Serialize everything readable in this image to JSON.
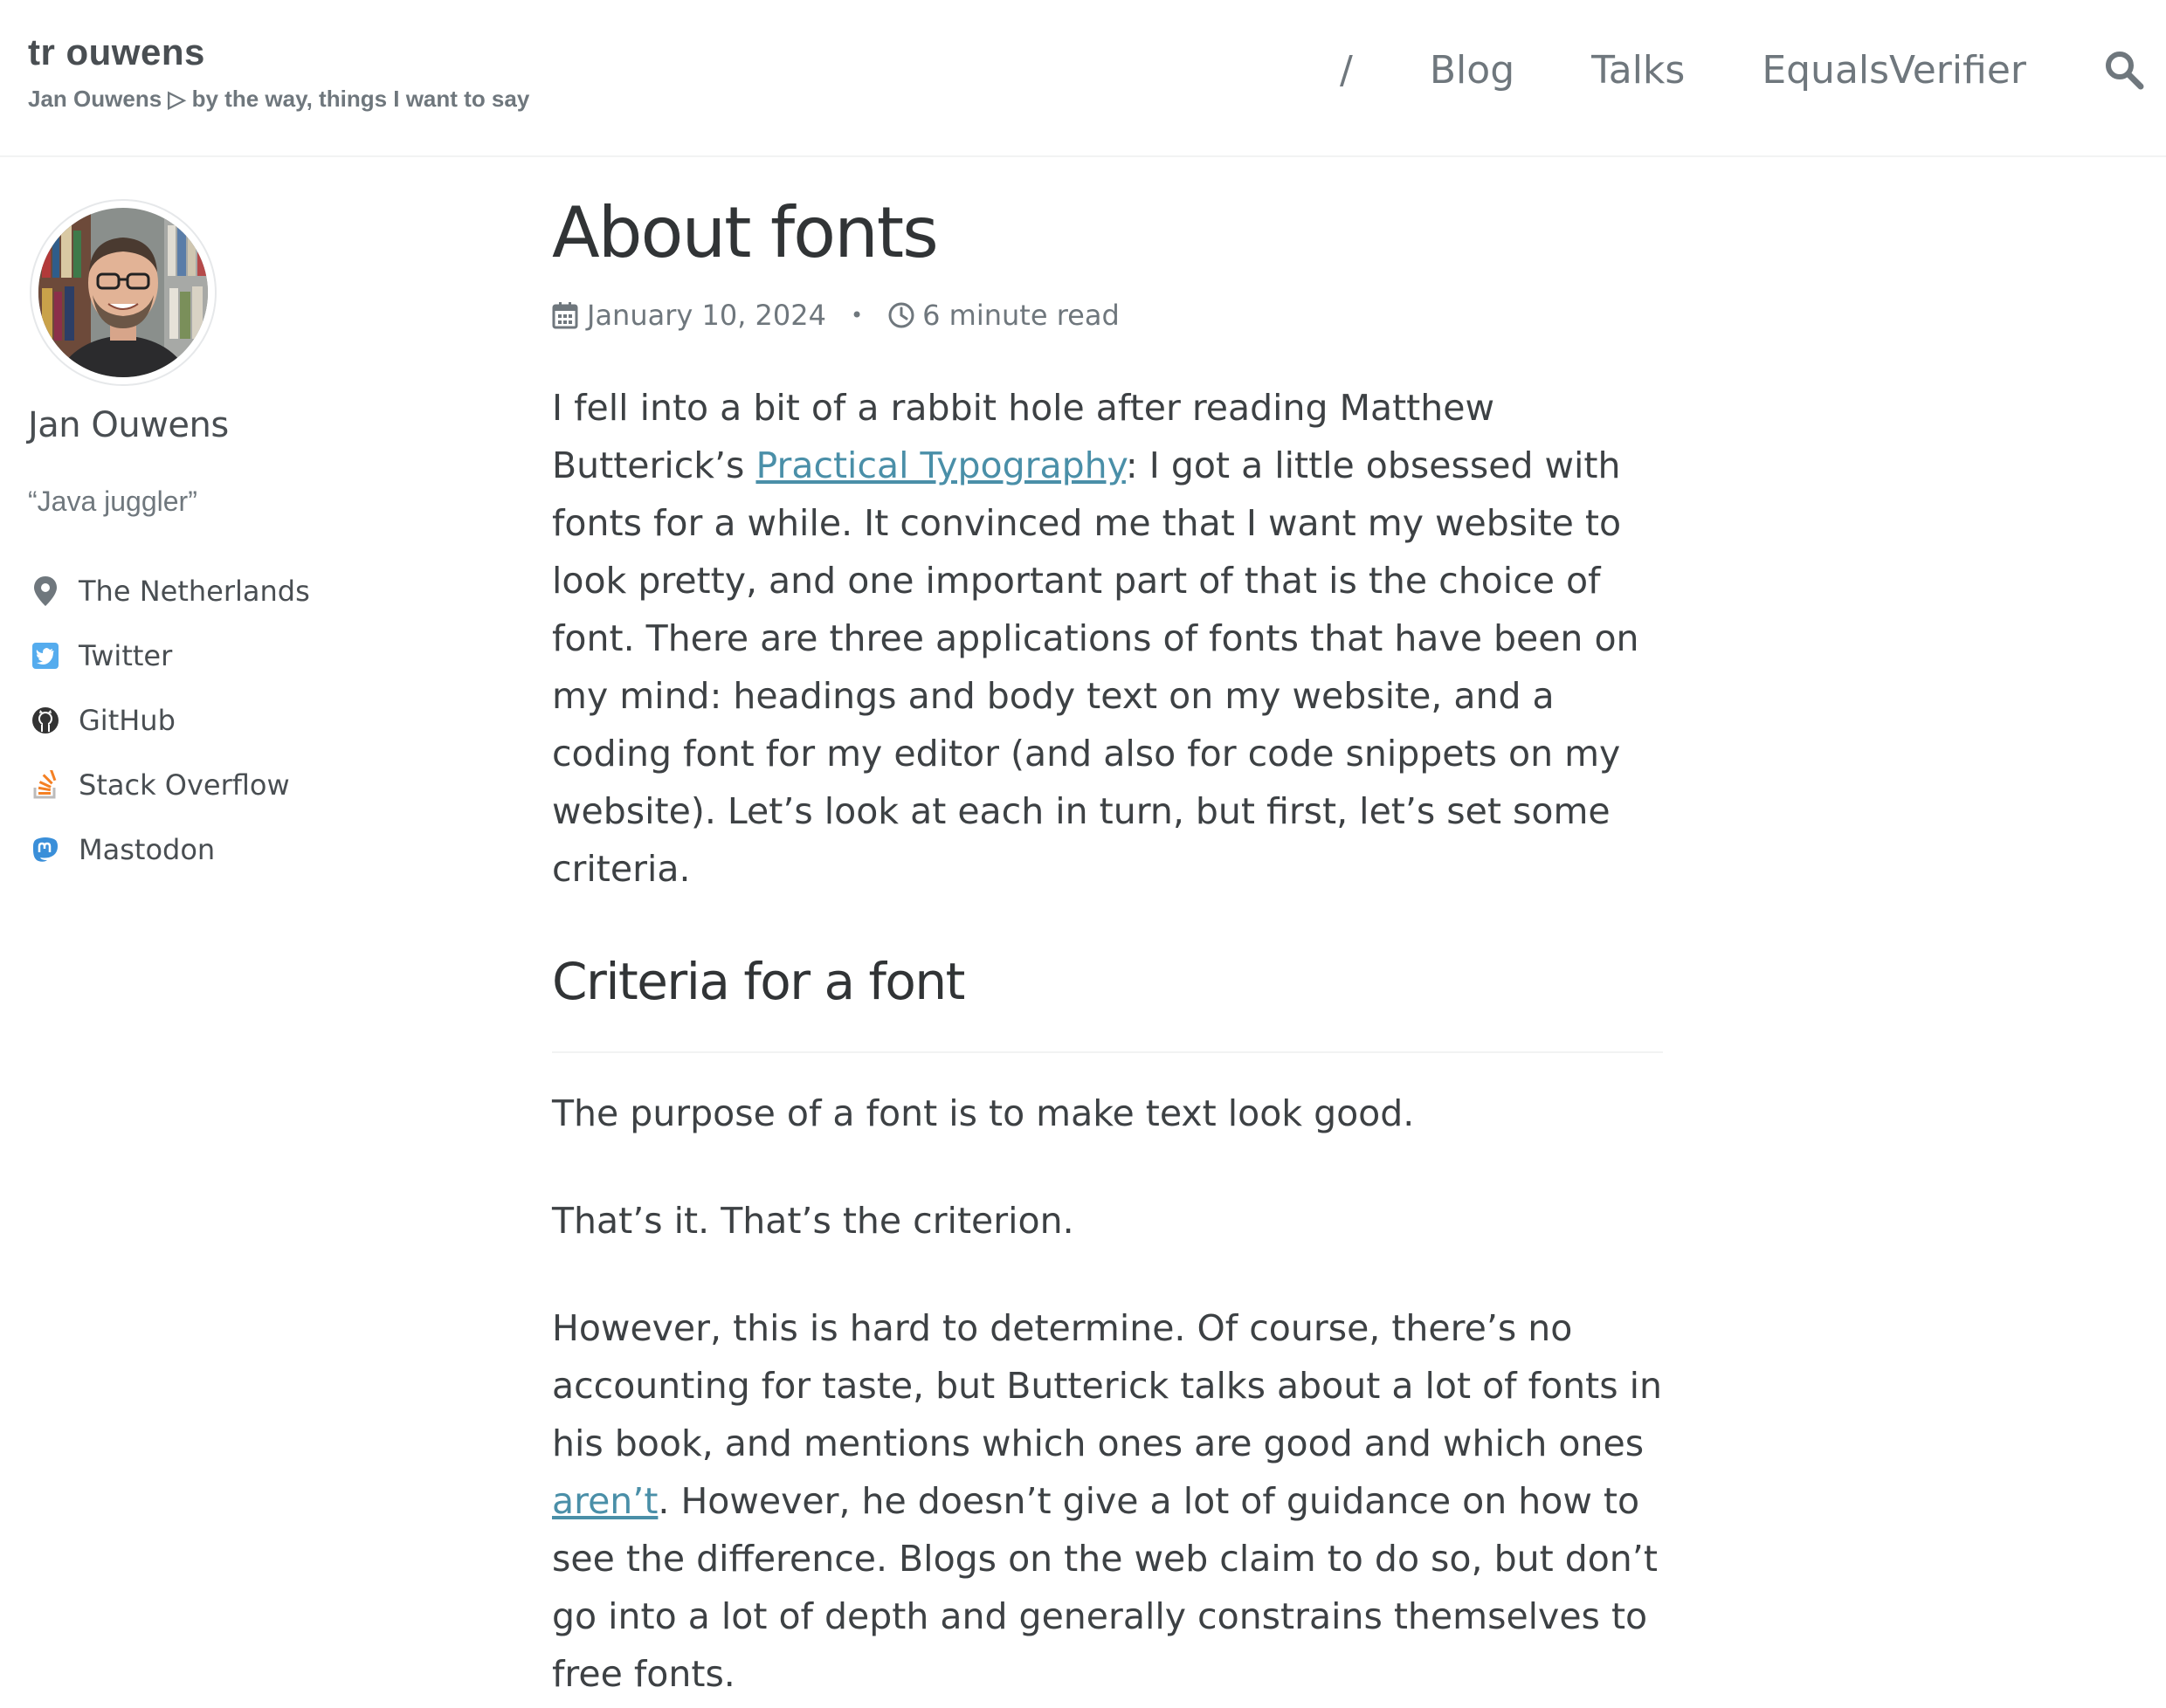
{
  "masthead": {
    "site_title": "tr ouwens",
    "site_subtitle": "Jan Ouwens ▷ by the way, things I want to say",
    "nav": [
      {
        "label": "/"
      },
      {
        "label": "Blog"
      },
      {
        "label": "Talks"
      },
      {
        "label": "EqualsVerifier"
      }
    ],
    "search_icon": "search-icon"
  },
  "sidebar": {
    "avatar": "author-photo",
    "name": "Jan Ouwens",
    "bio": "“Java juggler”",
    "links": [
      {
        "icon": "map-marker-icon",
        "label": "The Netherlands",
        "color": "#6f777d"
      },
      {
        "icon": "twitter-icon",
        "label": "Twitter",
        "color": "#55acee"
      },
      {
        "icon": "github-icon",
        "label": "GitHub",
        "color": "#333333"
      },
      {
        "icon": "stack-overflow-icon",
        "label": "Stack Overflow",
        "color": "#f48024"
      },
      {
        "icon": "mastodon-icon",
        "label": "Mastodon",
        "color": "#3a8fd9"
      }
    ]
  },
  "article": {
    "title": "About fonts",
    "date": "January 10, 2024",
    "separator": "•",
    "read_time": "6 minute read",
    "intro": {
      "before_link": "I fell into a bit of a rabbit hole after reading Matthew Butterick’s ",
      "link": "Practical Typography",
      "after_link": ": I got a little obsessed with fonts for a while. It convinced me that I want my website to look pretty, and one important part of that is the choice of font. There are three applications of fonts that have been on my mind: headings and body text on my website, and a coding font for my editor (and also for code snippets on my website). Let’s look at each in turn, but first, let’s set some criteria."
    },
    "section_heading": "Criteria for a font",
    "p1": "The purpose of a font is to make text look good.",
    "p2": "That’s it. That’s the criterion.",
    "p3": {
      "before_link": "However, this is hard to determine. Of course, there’s no accounting for taste, but Butterick talks about a lot of fonts in his book, and mentions which ones are good and which ones ",
      "link": "aren’t",
      "after_link": ". However, he doesn’t give a lot of guidance on how to see the difference. Blogs on the web claim to do so, but don’t go into a lot of depth and generally constrains themselves to free fonts."
    },
    "link_color": "#4a8fa8"
  }
}
